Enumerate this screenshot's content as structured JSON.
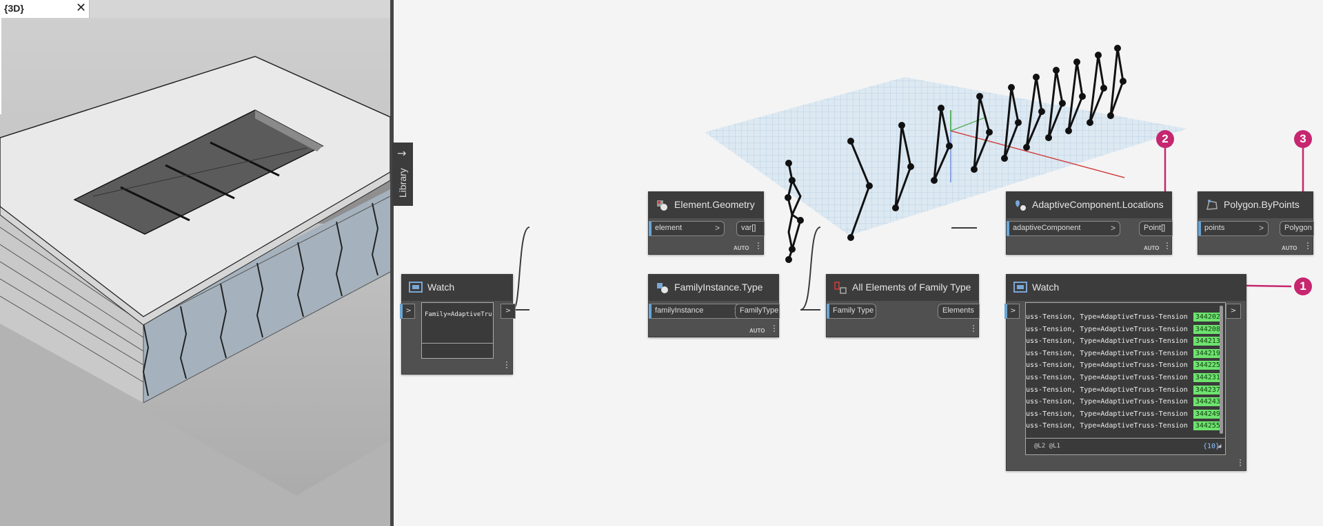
{
  "revit": {
    "tab_title": "{3D}",
    "close_glyph": "✕"
  },
  "library": {
    "label": "Library",
    "arrow": "→"
  },
  "nodes": {
    "watch_small": {
      "title": "Watch",
      "in_chev": ">",
      "out_chev": ">",
      "value": "Family=AdaptiveTruss-Tension, Type=Adapt"
    },
    "element_geometry": {
      "title": "Element.Geometry",
      "input": "element",
      "output": "var[]",
      "lacing": "AUTO"
    },
    "familyinstance_type": {
      "title": "FamilyInstance.Type",
      "input": "familyInstance",
      "output": "FamilyType",
      "lacing": "AUTO"
    },
    "all_elements": {
      "title": "All Elements of Family Type",
      "input": "Family Type",
      "output": "Elements"
    },
    "adaptive_locations": {
      "title": "AdaptiveComponent.Locations",
      "input": "adaptiveComponent",
      "output": "Point[]",
      "lacing": "AUTO"
    },
    "polygon_bypoints": {
      "title": "Polygon.ByPoints",
      "input": "points",
      "output": "Polygon",
      "lacing": "AUTO"
    },
    "watch_list": {
      "title": "Watch",
      "in_chev": ">",
      "out_chev": ">",
      "rows": [
        {
          "text": "uss-Tension, Type=AdaptiveTruss-Tension",
          "id": "344202"
        },
        {
          "text": "uss-Tension, Type=AdaptiveTruss-Tension",
          "id": "344208"
        },
        {
          "text": "uss-Tension, Type=AdaptiveTruss-Tension",
          "id": "344213"
        },
        {
          "text": "uss-Tension, Type=AdaptiveTruss-Tension",
          "id": "344219"
        },
        {
          "text": "uss-Tension, Type=AdaptiveTruss-Tension",
          "id": "344225"
        },
        {
          "text": "uss-Tension, Type=AdaptiveTruss-Tension",
          "id": "344231"
        },
        {
          "text": "uss-Tension, Type=AdaptiveTruss-Tension",
          "id": "344237"
        },
        {
          "text": "uss-Tension, Type=AdaptiveTruss-Tension",
          "id": "344243"
        },
        {
          "text": "uss-Tension, Type=AdaptiveTruss-Tension",
          "id": "344249"
        },
        {
          "text": "uss-Tension, Type=AdaptiveTruss-Tension",
          "id": "344255"
        }
      ],
      "levels": "@L2 @L1",
      "count": "{10}"
    }
  },
  "callouts": {
    "one": "1",
    "two": "2",
    "three": "3"
  },
  "colors": {
    "accent": "#c6266f",
    "id_badge": "#6ee36e",
    "node_body": "#505050",
    "node_header": "#3c3c3c"
  }
}
